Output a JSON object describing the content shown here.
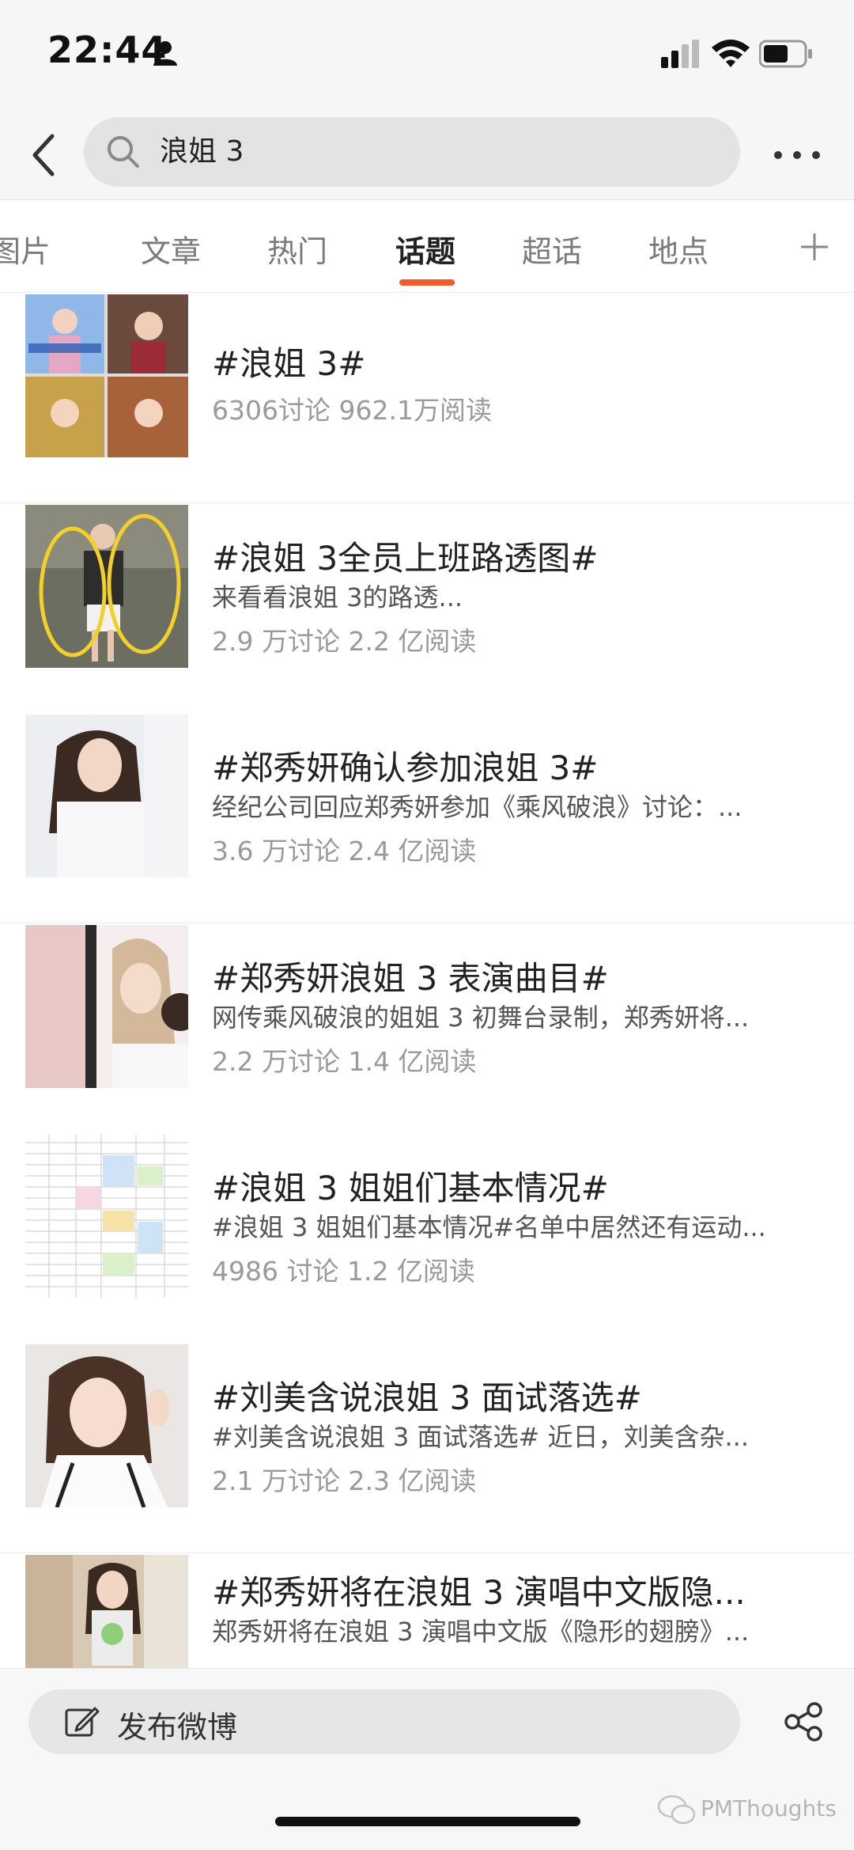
{
  "status_bar": {
    "time": "22:44"
  },
  "search": {
    "query": "浪姐 3"
  },
  "tabs": [
    {
      "label": "图片"
    },
    {
      "label": "文章"
    },
    {
      "label": "热门"
    },
    {
      "label": "话题",
      "active": true
    },
    {
      "label": "超话"
    },
    {
      "label": "地点"
    }
  ],
  "topics": [
    {
      "title": "#浪姐 3#",
      "desc": "",
      "stats": "6306讨论 962.1万阅读"
    },
    {
      "title": "#浪姐 3全员上班路透图#",
      "desc": "来看看浪姐 3的路透...",
      "stats": "2.9 万讨论 2.2 亿阅读"
    },
    {
      "title": "#郑秀妍确认参加浪姐 3#",
      "desc": "经纪公司回应郑秀妍参加《乘风破浪》讨论：...",
      "stats": "3.6 万讨论 2.4 亿阅读"
    },
    {
      "title": "#郑秀妍浪姐 3 表演曲目#",
      "desc": "网传乘风破浪的姐姐 3 初舞台录制，郑秀妍将...",
      "stats": "2.2 万讨论 1.4 亿阅读"
    },
    {
      "title": "#浪姐 3 姐姐们基本情况#",
      "desc": "#浪姐 3 姐姐们基本情况#名单中居然还有运动...",
      "stats": "4986 讨论 1.2 亿阅读"
    },
    {
      "title": "#刘美含说浪姐 3 面试落选#",
      "desc": "#刘美含说浪姐 3 面试落选# 近日，刘美含杂...",
      "stats": "2.1 万讨论 2.3 亿阅读"
    },
    {
      "title": "#郑秀妍将在浪姐 3 演唱中文版隐...",
      "desc": "郑秀妍将在浪姐 3 演唱中文版《隐形的翅膀》...",
      "stats": ""
    }
  ],
  "bottom": {
    "compose_label": "发布微博",
    "watermark": "PMThoughts"
  },
  "colors": {
    "accent": "#ef5b2a",
    "title": "#222222",
    "meta": "#9a9a9a"
  }
}
